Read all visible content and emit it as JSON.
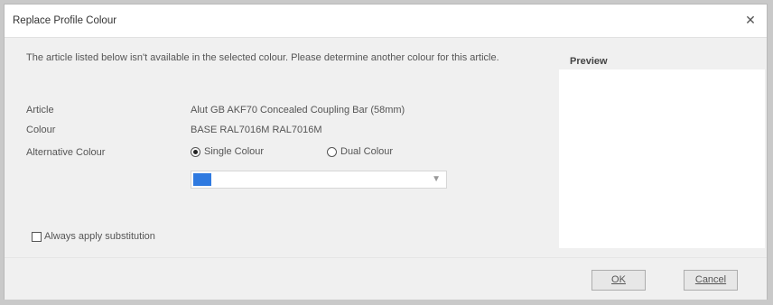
{
  "window": {
    "title": "Replace Profile Colour",
    "close_glyph": "✕"
  },
  "description": "The article listed below isn't available in the selected colour. Please determine another colour for this article.",
  "fields": {
    "article_label": "Article",
    "article_value": "Alut GB AKF70 Concealed Coupling Bar (58mm)",
    "colour_label": "Colour",
    "colour_value": "BASE RAL7016M RAL7016M",
    "alt_colour_label": "Alternative Colour"
  },
  "radios": {
    "single_label": "Single Colour",
    "dual_label": "Dual Colour",
    "selected": "single"
  },
  "dropdown": {
    "selected_value": "",
    "arrow_icon": "chevron-down-icon"
  },
  "checkbox": {
    "label": "Always apply substitution",
    "checked": false
  },
  "preview": {
    "title": "Preview"
  },
  "buttons": {
    "ok_label": "OK",
    "cancel_label": "Cancel"
  }
}
